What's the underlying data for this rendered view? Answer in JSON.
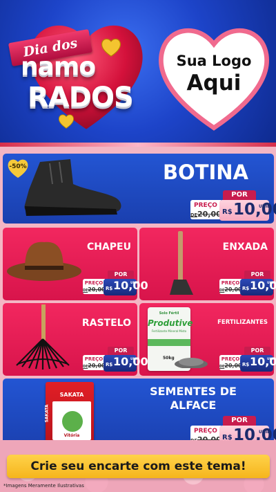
{
  "header": {
    "ribbon": "Dia dos",
    "word_1": "namo",
    "word_2": "mo",
    "word_3": "RADOS",
    "logo_line_1": "Sua Logo",
    "logo_line_2": "Aqui"
  },
  "products": [
    {
      "name": "BOTINA",
      "badge": "-50%",
      "por": "POR",
      "preco_label": "PREÇO",
      "old_prefix": "DE",
      "old_price": "20,00",
      "currency": "R$",
      "price": "10,00",
      "unit": "UNID"
    },
    {
      "name": "CHAPEU",
      "por": "POR",
      "preco_label": "PREÇO",
      "old_prefix": "DE",
      "old_price": "20,00",
      "currency": "R$",
      "price": "10,00",
      "unit": "UNID"
    },
    {
      "name": "ENXADA",
      "por": "POR",
      "preco_label": "PREÇO",
      "old_prefix": "DE",
      "old_price": "20,00",
      "currency": "R$",
      "price": "10,00",
      "unit": "UNID"
    },
    {
      "name": "RASTELO",
      "por": "POR",
      "preco_label": "PREÇO",
      "old_prefix": "DE",
      "old_price": "20,00",
      "currency": "R$",
      "price": "10,00",
      "unit": "UNID"
    },
    {
      "name": "FERTILIZANTES",
      "product_label": "Produtive",
      "product_sub": "Fertilizante Mineral Misto",
      "product_weight": "50kg",
      "brand_small": "Solo Fértil",
      "por": "POR",
      "preco_label": "PREÇO",
      "old_prefix": "DE",
      "old_price": "20,00",
      "currency": "R$",
      "price": "10,00",
      "unit": "UNID"
    },
    {
      "name_line_1": "SEMENTES DE",
      "name_line_2": "ALFACE",
      "package_brand": "SAKATA",
      "package_side": "SAKATA",
      "package_product": "Vitória",
      "por": "POR",
      "preco_label": "PREÇO",
      "old_prefix": "DE",
      "old_price": "20,00",
      "currency": "R$",
      "price": "10,00",
      "unit": "UNID"
    }
  ],
  "footer": {
    "cta": "Crie seu encarte com este tema!",
    "disclaimer": "*Imagens Meramente Ilustrativas"
  },
  "colors": {
    "blue_card": "#1f4cc8",
    "pink_card": "#e61d55",
    "cta_yellow": "#f9c22e",
    "header_blue": "#1d44c9"
  }
}
